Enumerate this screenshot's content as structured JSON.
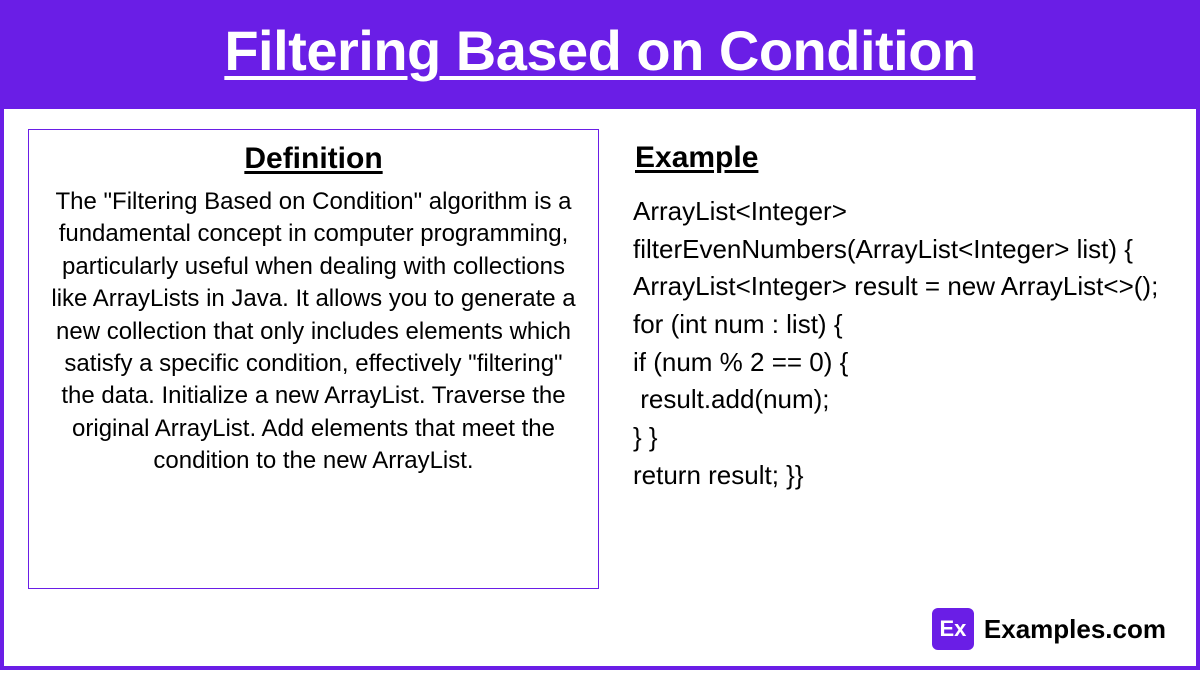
{
  "header": {
    "title": "Filtering Based on Condition"
  },
  "left": {
    "heading": "Definition",
    "body": "The \"Filtering Based on Condition\" algorithm is a fundamental concept in computer programming, particularly useful when dealing with collections like ArrayLists in Java. It allows you to generate a new collection that only includes elements which satisfy a specific condition, effectively \"filtering\" the data. Initialize a new ArrayList. Traverse the original ArrayList. Add elements that meet the condition to the new ArrayList."
  },
  "right": {
    "heading": "Example",
    "code": "ArrayList<Integer> filterEvenNumbers(ArrayList<Integer> list) {\nArrayList<Integer> result = new ArrayList<>();\nfor (int num : list) {\nif (num % 2 == 0) {\n result.add(num);\n} }\nreturn result; }}"
  },
  "footer": {
    "logo_abbrev": "Ex",
    "logo_text": "Examples.com"
  }
}
